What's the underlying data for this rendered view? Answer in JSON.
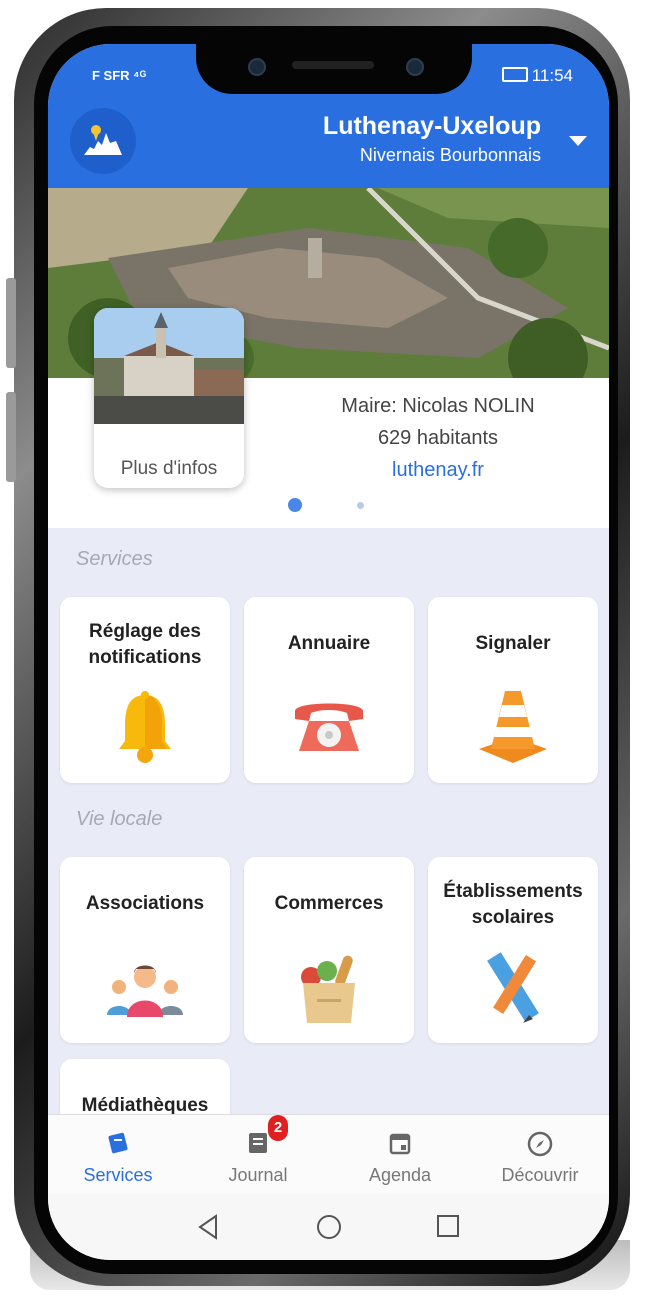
{
  "status_bar": {
    "carrier": "F SFR ⁴ᴳ",
    "time": "11:54"
  },
  "header": {
    "town_name": "Luthenay-Uxeloup",
    "region": "Nivernais Bourbonnais"
  },
  "info": {
    "card_label": "Plus d'infos",
    "mayor": "Maire: Nicolas NOLIN",
    "population": "629 habitants",
    "website": "luthenay.fr"
  },
  "sections": {
    "services_title": "Services",
    "vie_locale_title": "Vie locale"
  },
  "services": [
    {
      "label_line1": "Réglage des",
      "label_line2": "notifications",
      "icon": "bell-icon"
    },
    {
      "label_line1": "Annuaire",
      "label_line2": "",
      "icon": "telephone-icon"
    },
    {
      "label_line1": "Signaler",
      "label_line2": "",
      "icon": "traffic-cone-icon"
    }
  ],
  "vie_locale": [
    {
      "label_line1": "Associations",
      "label_line2": "",
      "icon": "people-group-icon"
    },
    {
      "label_line1": "Commerces",
      "label_line2": "",
      "icon": "grocery-bag-icon"
    },
    {
      "label_line1": "Établissements",
      "label_line2": "scolaires",
      "icon": "ruler-pencil-icon"
    },
    {
      "label_line1": "Médiathèques",
      "label_line2": "",
      "icon": "book-icon"
    }
  ],
  "bottom_nav": [
    {
      "label": "Services",
      "icon": "services-icon",
      "active": true
    },
    {
      "label": "Journal",
      "icon": "newspaper-icon",
      "badge": "2"
    },
    {
      "label": "Agenda",
      "icon": "calendar-icon"
    },
    {
      "label": "Découvrir",
      "icon": "compass-icon"
    }
  ],
  "colors": {
    "primary": "#2a6fe0",
    "background": "#e9ecf6"
  }
}
